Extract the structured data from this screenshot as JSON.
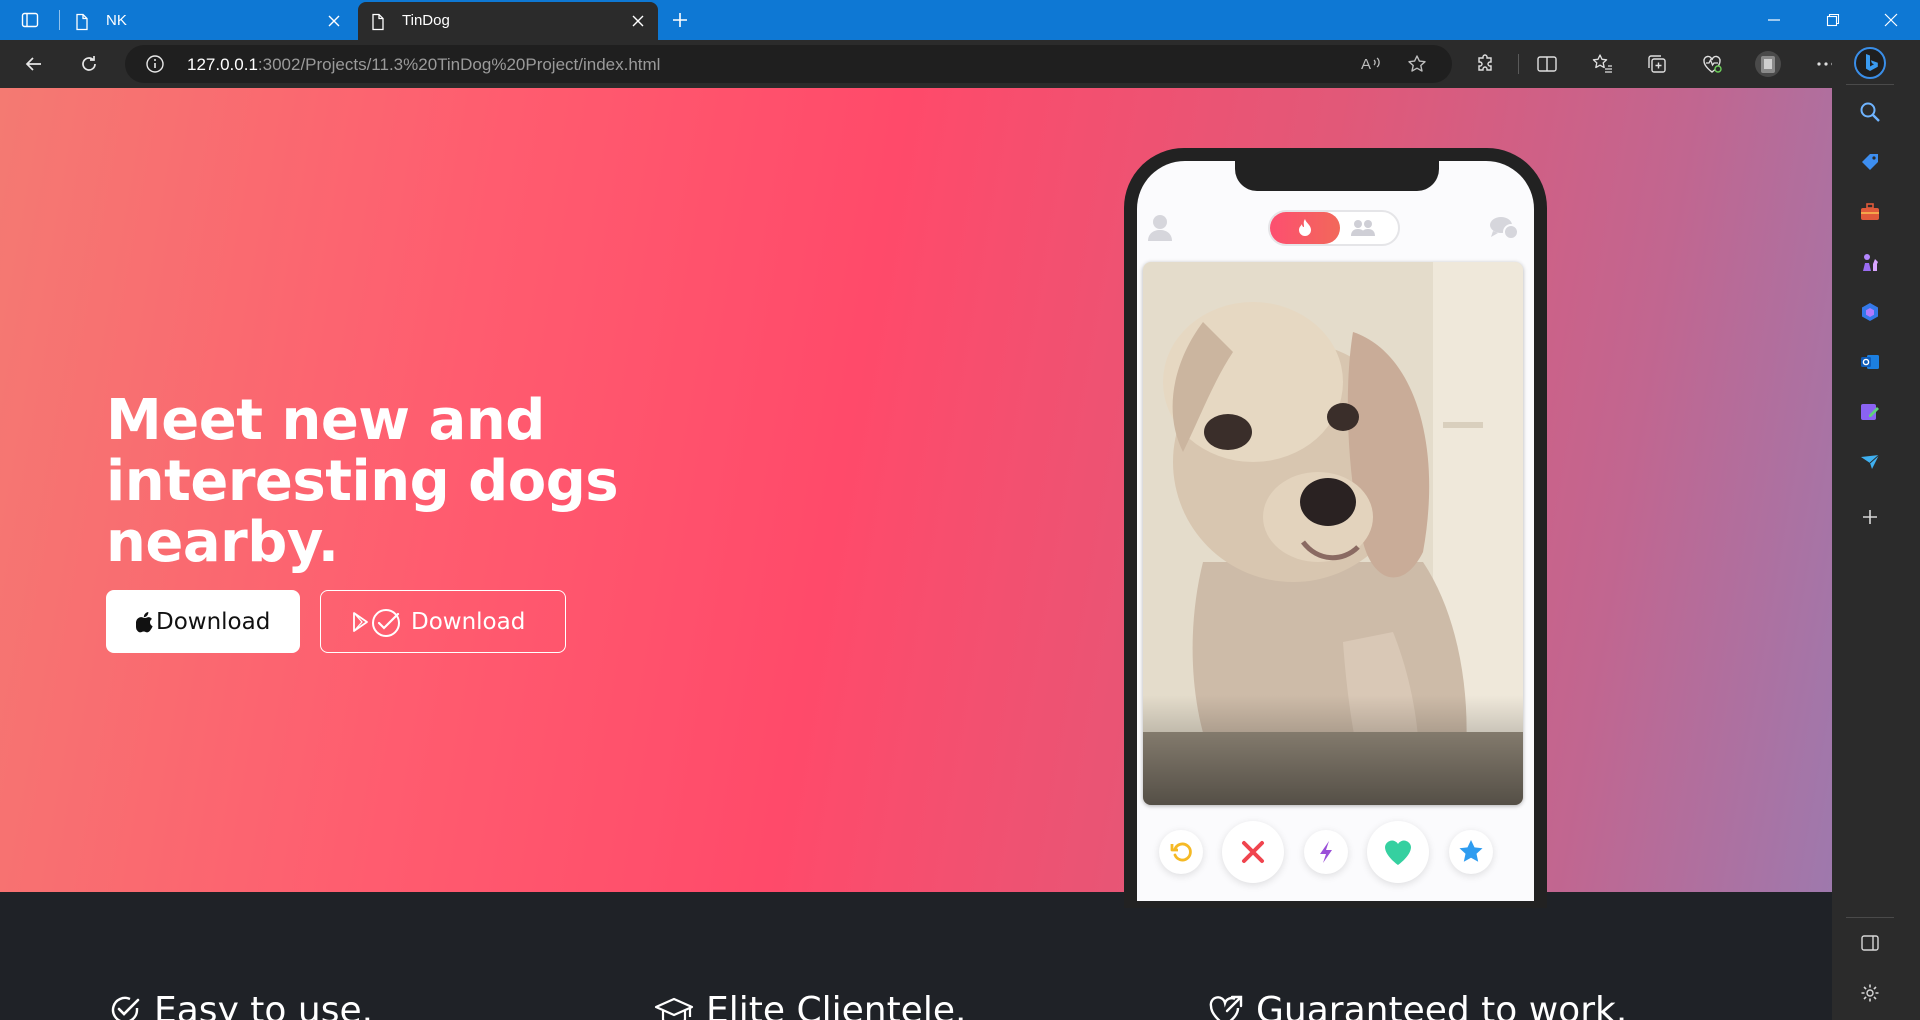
{
  "browser": {
    "tabs": [
      {
        "title": "NK",
        "active": false
      },
      {
        "title": "TinDog",
        "active": true
      }
    ],
    "url_host": "127.0.0.1",
    "url_rest": ":3002/Projects/11.3%20TinDog%20Project/index.html"
  },
  "hero": {
    "headline": "Meet new and interesting dogs nearby.",
    "apple_button_label": "Download",
    "play_button_label": "Download"
  },
  "features": [
    {
      "title": "Easy to use.",
      "icon": "circle-check-icon"
    },
    {
      "title": "Elite Clientele.",
      "icon": "graduation-cap-icon"
    },
    {
      "title": "Guaranteed to work.",
      "icon": "heart-arrow-icon"
    }
  ],
  "colors": {
    "brand_red": "#ff4c68",
    "brand_coral": "#f47a72",
    "brand_purple": "#9e79ad",
    "dark_section": "#1f2227",
    "edge_titlebar": "#0e78d4"
  }
}
